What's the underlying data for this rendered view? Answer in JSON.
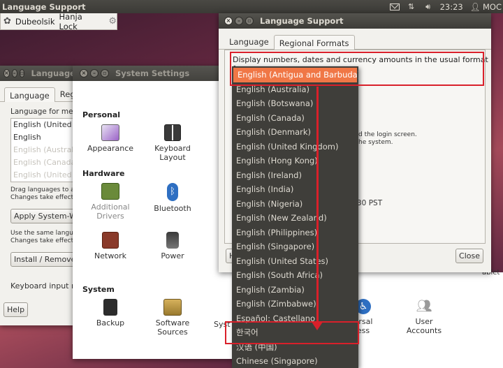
{
  "top_panel": {
    "title": "Language Support",
    "clock": "23:23",
    "user": "MOC",
    "icons": [
      "mail-icon",
      "network-icon",
      "volume-icon",
      "user-icon"
    ]
  },
  "ime_bar": {
    "input_method": "Dubeolsik",
    "hanja_lock": "Hanja Lock",
    "icons": [
      "ime-logo-icon",
      "gear-icon"
    ]
  },
  "lang_back_window": {
    "title": "Language",
    "tabs": [
      "Language",
      "Regio"
    ],
    "label": "Language for men",
    "list": [
      "English (United S",
      "English",
      "English (Australi",
      "English (Canada)",
      "English (United K"
    ],
    "note1": "Drag languages to arr",
    "note2": "Changes take effect n",
    "apply_button": "Apply System-Wi",
    "note3": "Use the same languag",
    "note4": "Changes take effect o",
    "install_button": "Install / Remove",
    "keyboard_label": "Keyboard input m",
    "help_button": "Help"
  },
  "system_settings": {
    "title": "System Settings",
    "sections": {
      "personal": "Personal",
      "hardware": "Hardware",
      "system": "System"
    },
    "items": {
      "appearance": "Appearance",
      "keyboard_layout_1": "Keyboard",
      "keyboard_layout_2": "Layout",
      "additional_drivers_1": "Additional",
      "additional_drivers_2": "Drivers",
      "bluetooth": "Bluetooth",
      "network": "Network",
      "power": "Power",
      "backup": "Backup",
      "software_sources_1": "Software",
      "software_sources_2": "Sources",
      "system_partial": "Syst",
      "universal_access_1": "ersal",
      "universal_access_2": "ess",
      "user_accounts_1": "User",
      "user_accounts_2": "Accounts",
      "tablet_partial": "ablet"
    }
  },
  "language_support": {
    "title": "Language Support",
    "tabs": [
      "Language",
      "Regional Formats"
    ],
    "format_label": "Display numbers, dates and currency amounts in the usual format for:",
    "bg_text_1": "d the login screen.",
    "bg_text_2": "he system.",
    "bg_text_3": "30 PST",
    "help_partial": "H",
    "close_button": "Close"
  },
  "dropdown": {
    "selected": "English (Antigua and Barbuda)",
    "options": [
      "English (Australia)",
      "English (Botswana)",
      "English (Canada)",
      "English (Denmark)",
      "English (United Kingdom)",
      "English (Hong Kong)",
      "English (Ireland)",
      "English (India)",
      "English (Nigeria)",
      "English (New Zealand)",
      "English (Philippines)",
      "English (Singapore)",
      "English (United States)",
      "English (South Africa)",
      "English (Zambia)",
      "English (Zimbabwe)",
      "Español: Castellano",
      "한국어",
      "汉语 (中国)",
      "Chinese (Singapore)"
    ]
  },
  "colors": {
    "accent": "#f07746",
    "annotation": "#d9202a",
    "panel": "#3c3b37"
  }
}
